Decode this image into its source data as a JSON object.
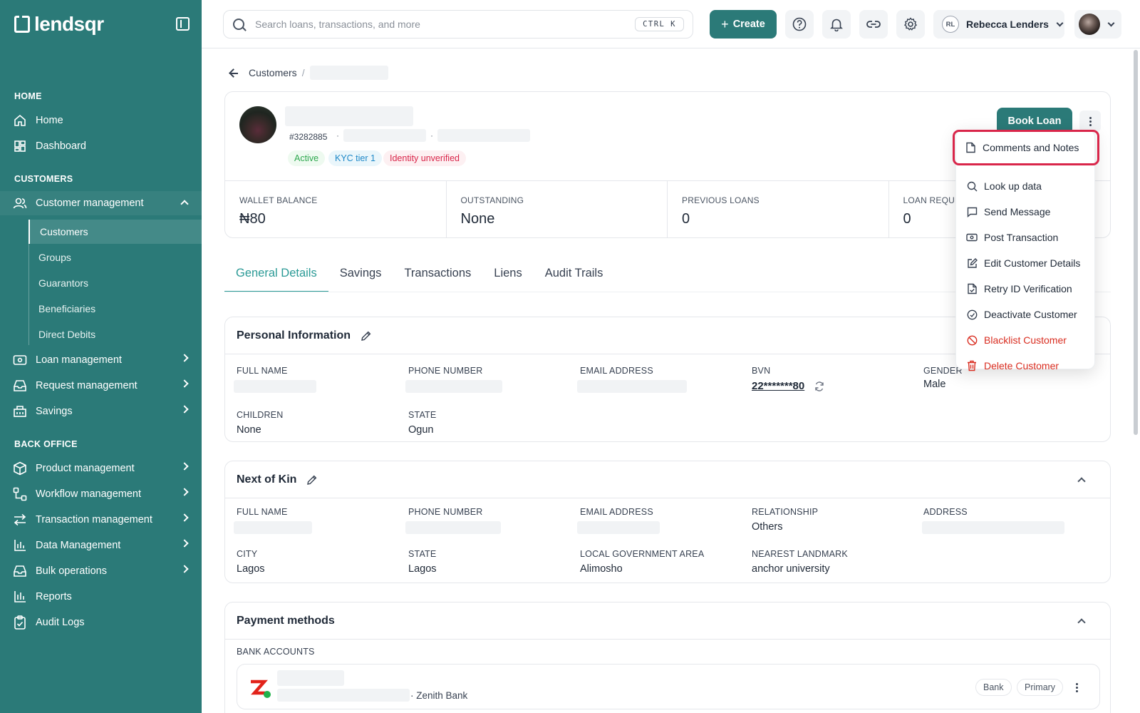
{
  "brand": {
    "name": "lendsqr"
  },
  "sidebar": {
    "sections": {
      "home": "HOME",
      "customers": "CUSTOMERS",
      "back_office": "BACK OFFICE"
    },
    "items": {
      "home": "Home",
      "dashboard": "Dashboard",
      "customer_management": "Customer management",
      "loan_management": "Loan management",
      "request_management": "Request management",
      "savings": "Savings",
      "product_management": "Product management",
      "workflow_management": "Workflow management",
      "transaction_management": "Transaction management",
      "data_management": "Data Management",
      "bulk_operations": "Bulk operations",
      "reports": "Reports",
      "audit_logs": "Audit Logs"
    },
    "sub_items": [
      "Customers",
      "Groups",
      "Guarantors",
      "Beneficiaries",
      "Direct Debits"
    ],
    "active_sub": "Customers"
  },
  "topbar": {
    "search_placeholder": "Search loans, transactions, and more",
    "shortcut": "CTRL K",
    "create_label": "Create",
    "user_initials": "RL",
    "user_name": "Rebecca Lenders"
  },
  "breadcrumb": {
    "root": "Customers",
    "sep": "/"
  },
  "profile": {
    "customer_id": "#3282885",
    "badges": [
      "Active",
      "KYC tier 1",
      "Identity unverified"
    ],
    "book_loan_label": "Book Loan"
  },
  "stats": [
    {
      "label": "WALLET BALANCE",
      "value": "₦80"
    },
    {
      "label": "OUTSTANDING",
      "value": "None"
    },
    {
      "label": "PREVIOUS LOANS",
      "value": "0"
    },
    {
      "label": "LOAN REQUE",
      "value": "0"
    }
  ],
  "tabs": [
    "General Details",
    "Savings",
    "Transactions",
    "Liens",
    "Audit Trails"
  ],
  "personal_info": {
    "title": "Personal Information",
    "labels": {
      "full_name": "FULL NAME",
      "phone": "PHONE NUMBER",
      "email": "EMAIL ADDRESS",
      "bvn": "BVN",
      "gender": "GENDER",
      "children": "CHILDREN",
      "state": "STATE"
    },
    "values": {
      "bvn": "22*******80",
      "gender": "Male",
      "children": "None",
      "state": "Ogun"
    }
  },
  "next_of_kin": {
    "title": "Next of Kin",
    "labels": {
      "full_name": "FULL NAME",
      "phone": "PHONE NUMBER",
      "email": "EMAIL ADDRESS",
      "relationship": "RELATIONSHIP",
      "address": "ADDRESS",
      "city": "CITY",
      "state": "STATE",
      "lga": "LOCAL GOVERNMENT AREA",
      "landmark": "NEAREST LANDMARK"
    },
    "values": {
      "relationship": "Others",
      "city": "Lagos",
      "state": "Lagos",
      "lga": "Alimosho",
      "landmark": "anchor university"
    }
  },
  "payment_methods": {
    "title": "Payment methods",
    "bank_accounts_label": "BANK ACCOUNTS",
    "bank_name": "· Zenith Bank",
    "chips": [
      "Bank",
      "Primary"
    ]
  },
  "menu": {
    "items": [
      {
        "label": "Comments and Notes",
        "icon": "file-icon"
      },
      {
        "label": "Look up data",
        "icon": "search-icon"
      },
      {
        "label": "Send Message",
        "icon": "message-icon"
      },
      {
        "label": "Post Transaction",
        "icon": "cash-icon"
      },
      {
        "label": "Edit Customer Details",
        "icon": "edit-icon"
      },
      {
        "label": "Retry ID Verification",
        "icon": "file-check-icon"
      },
      {
        "label": "Deactivate Customer",
        "icon": "check-circle-icon"
      },
      {
        "label": "Blacklist Customer",
        "icon": "ban-icon"
      },
      {
        "label": "Delete Customer",
        "icon": "trash-icon"
      }
    ]
  },
  "colors": {
    "brand": "#2b7a78",
    "active_tab": "#2b9a96",
    "danger": "#d92d20",
    "highlight": "#d9264a"
  }
}
